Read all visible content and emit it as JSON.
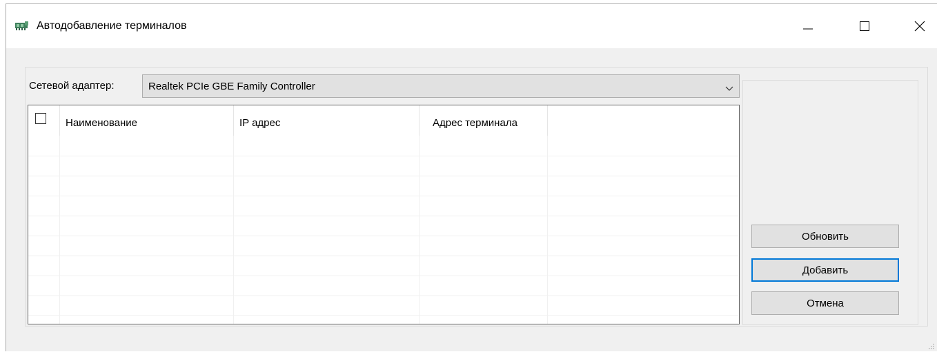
{
  "window": {
    "title": "Автодобавление терминалов",
    "icon": "network-card-icon"
  },
  "adapter": {
    "label": "Сетевой адаптер:",
    "selected": "Realtek PCIe GBE Family Controller"
  },
  "grid": {
    "columns": [
      "",
      "Наименование",
      "IP адрес",
      "Адрес терминала"
    ],
    "rows": []
  },
  "buttons": {
    "refresh": "Обновить",
    "add": "Добавить",
    "cancel": "Отмена"
  },
  "colors": {
    "focus_border": "#0078d7",
    "button_bg": "#e1e1e1",
    "window_bg": "#f0f0f0"
  }
}
